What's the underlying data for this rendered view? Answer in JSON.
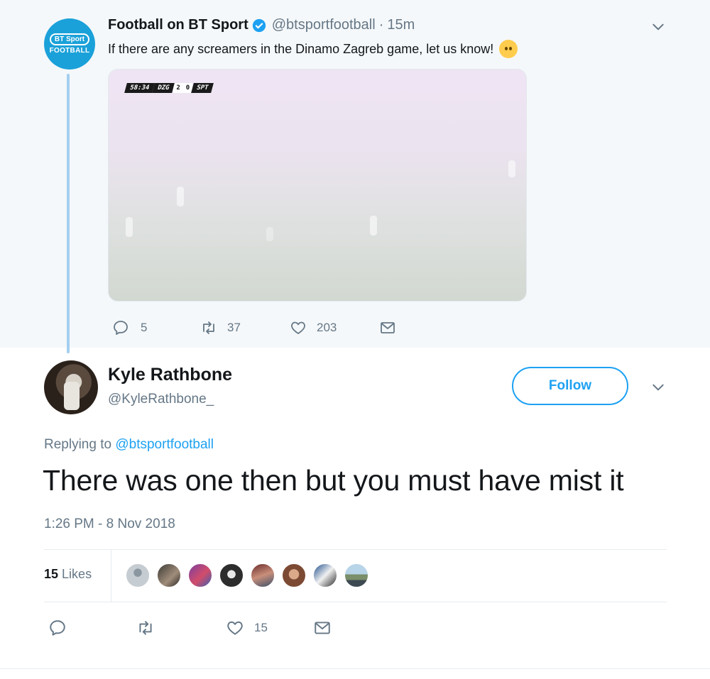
{
  "parent_tweet": {
    "avatar": {
      "line1": "BT Sport",
      "line2": "FOOTBALL"
    },
    "name": "Football on BT Sport",
    "handle": "@btsportfootball",
    "separator": "·",
    "time": "15m",
    "text": "If there are any screamers in the Dinamo Zagreb game, let us know!",
    "emoji": "neutral-face-emoji",
    "media": {
      "scoreboard": {
        "clock": "58:34",
        "home": "DZG",
        "home_score": "2",
        "away_score": "0",
        "away": "SPT"
      }
    },
    "actions": {
      "replies": "5",
      "retweets": "37",
      "likes": "203"
    }
  },
  "reply_tweet": {
    "name": "Kyle Rathbone",
    "handle": "@KyleRathbone_",
    "follow_label": "Follow",
    "replying_prefix": "Replying to",
    "replying_to": "@btsportfootball",
    "text": "There was one then but you must have mist it",
    "timestamp": "1:26 PM - 8 Nov 2018",
    "likes_count": "15",
    "likes_label": "Likes",
    "actions": {
      "likes": "15"
    }
  },
  "colors": {
    "accent": "#1da1f2",
    "thread_line": "#a3cff0",
    "parent_bg": "#f5f8fa",
    "muted": "#657786",
    "bt_blue": "#1ba1d9"
  }
}
